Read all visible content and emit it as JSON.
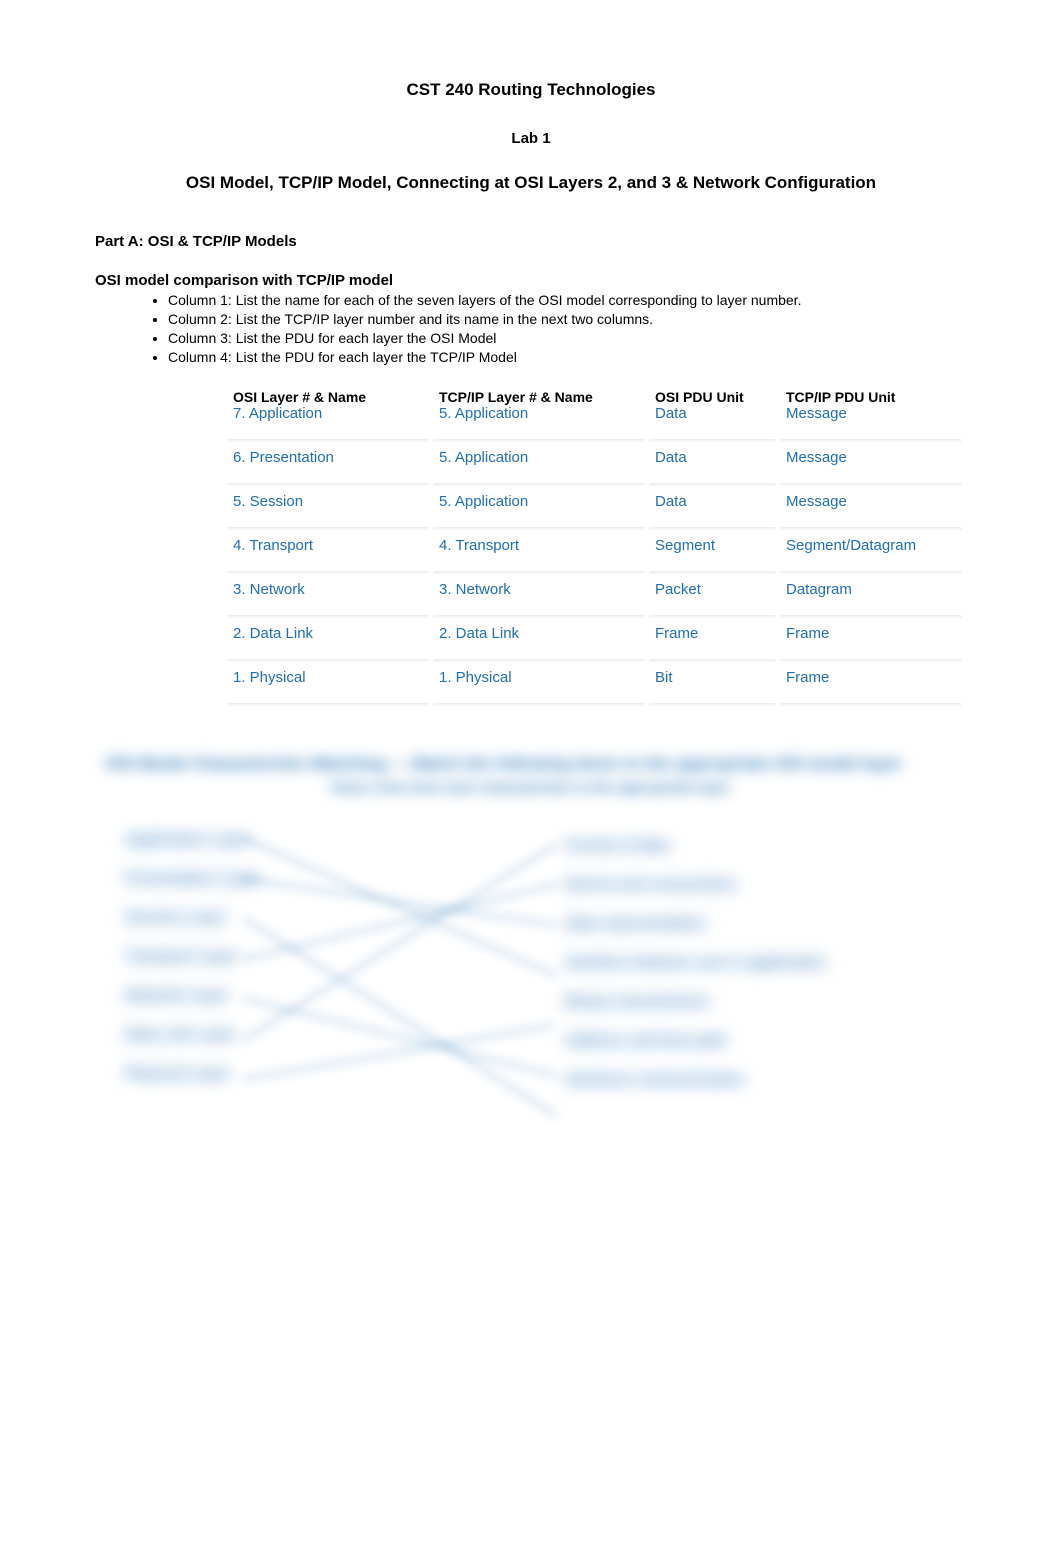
{
  "course_title": "CST 240 Routing Technologies",
  "lab_title": "Lab 1",
  "subtitle": "OSI Model, TCP/IP Model, Connecting at OSI Layers 2, and 3 & Network Configuration",
  "part_a_heading": "Part A: OSI & TCP/IP Models",
  "comparison_heading": "OSI model comparison with TCP/IP model",
  "column_desc": [
    "Column 1: List the name for each of the seven layers of the OSI model corresponding to layer number.",
    "Column 2: List the TCP/IP layer number and its name in the next two columns.",
    "Column 3: List the PDU for each layer the OSI Model",
    "Column 4: List the PDU for each layer the TCP/IP Model"
  ],
  "table": {
    "headers": {
      "osi": "OSI Layer # & Name",
      "tcp": "TCP/IP Layer # & Name",
      "opdu": "OSI PDU Unit",
      "tpdu": "TCP/IP PDU Unit"
    },
    "rows": [
      {
        "osi": "7. Application",
        "tcp": "5. Application",
        "opdu": "Data",
        "tpdu": "Message"
      },
      {
        "osi": "6. Presentation",
        "tcp": "5. Application",
        "opdu": "Data",
        "tpdu": "Message"
      },
      {
        "osi": "5. Session",
        "tcp": "5. Application",
        "opdu": "Data",
        "tpdu": "Message"
      },
      {
        "osi": "4. Transport",
        "tcp": "4. Transport",
        "opdu": "Segment",
        "tpdu": "Segment/Datagram"
      },
      {
        "osi": "3. Network",
        "tcp": "3. Network",
        "opdu": "Packet",
        "tpdu": "Datagram"
      },
      {
        "osi": "2. Data Link",
        "tcp": "2. Data Link",
        "opdu": "Frame",
        "tpdu": "Frame"
      },
      {
        "osi": "1. Physical",
        "tcp": "1. Physical",
        "opdu": "Bit",
        "tpdu": "Frame"
      }
    ]
  },
  "blurred": {
    "banner": "OSI Model Characteristic Matching — Match the following items to the appropriate OSI model layer",
    "sub": "Draw a line from each characteristic to the appropriate layer",
    "left": [
      "Application Layer",
      "Presentation Layer",
      "Session Layer",
      "Transport Layer",
      "Network Layer",
      "Data Link Layer",
      "Physical Layer"
    ],
    "right": [
      "Format of data",
      "End-to-end connections",
      "Data representation",
      "Interface between user & application",
      "Binary transmission",
      "Address and best path",
      "Interhost communication"
    ]
  }
}
